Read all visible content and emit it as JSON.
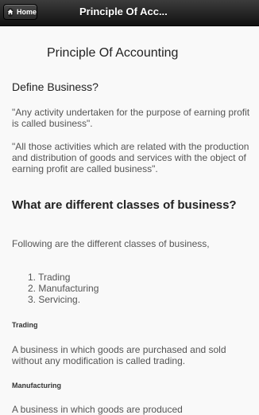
{
  "header": {
    "home_label": "Home",
    "title": "Principle Of Acc..."
  },
  "page": {
    "title": "Principle Of Accounting"
  },
  "sections": {
    "define_business": {
      "heading": "Define Business?",
      "p1": "\"Any activity undertaken for the purpose of earning profit is called business\".",
      "p2": "\"All those activities which are related with the production and distribution of goods and services with the object of earning profit are called business\"."
    },
    "classes": {
      "heading": "What are different classes of business?",
      "intro": "Following are the different classes of business,",
      "items": [
        "1. Trading",
        "2. Manufacturing",
        "3. Servicing."
      ]
    },
    "trading": {
      "heading": "Trading",
      "text": "A business in which goods are purchased and sold without any modification is called trading."
    },
    "manufacturing": {
      "heading": "Manufacturing",
      "text": "A business in which goods are produced"
    }
  }
}
